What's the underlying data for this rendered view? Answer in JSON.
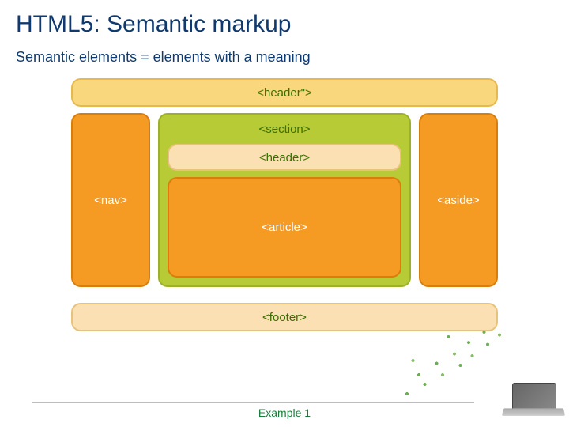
{
  "title": "HTML5: Semantic markup",
  "subtitle": "Semantic elements = elements with a meaning",
  "diagram": {
    "header": "<header\">",
    "nav": "<nav>",
    "section": "<section>",
    "inner_header": "<header>",
    "article": "<article>",
    "aside": "<aside>",
    "footer": "<footer>"
  },
  "footer_label": "Example 1"
}
